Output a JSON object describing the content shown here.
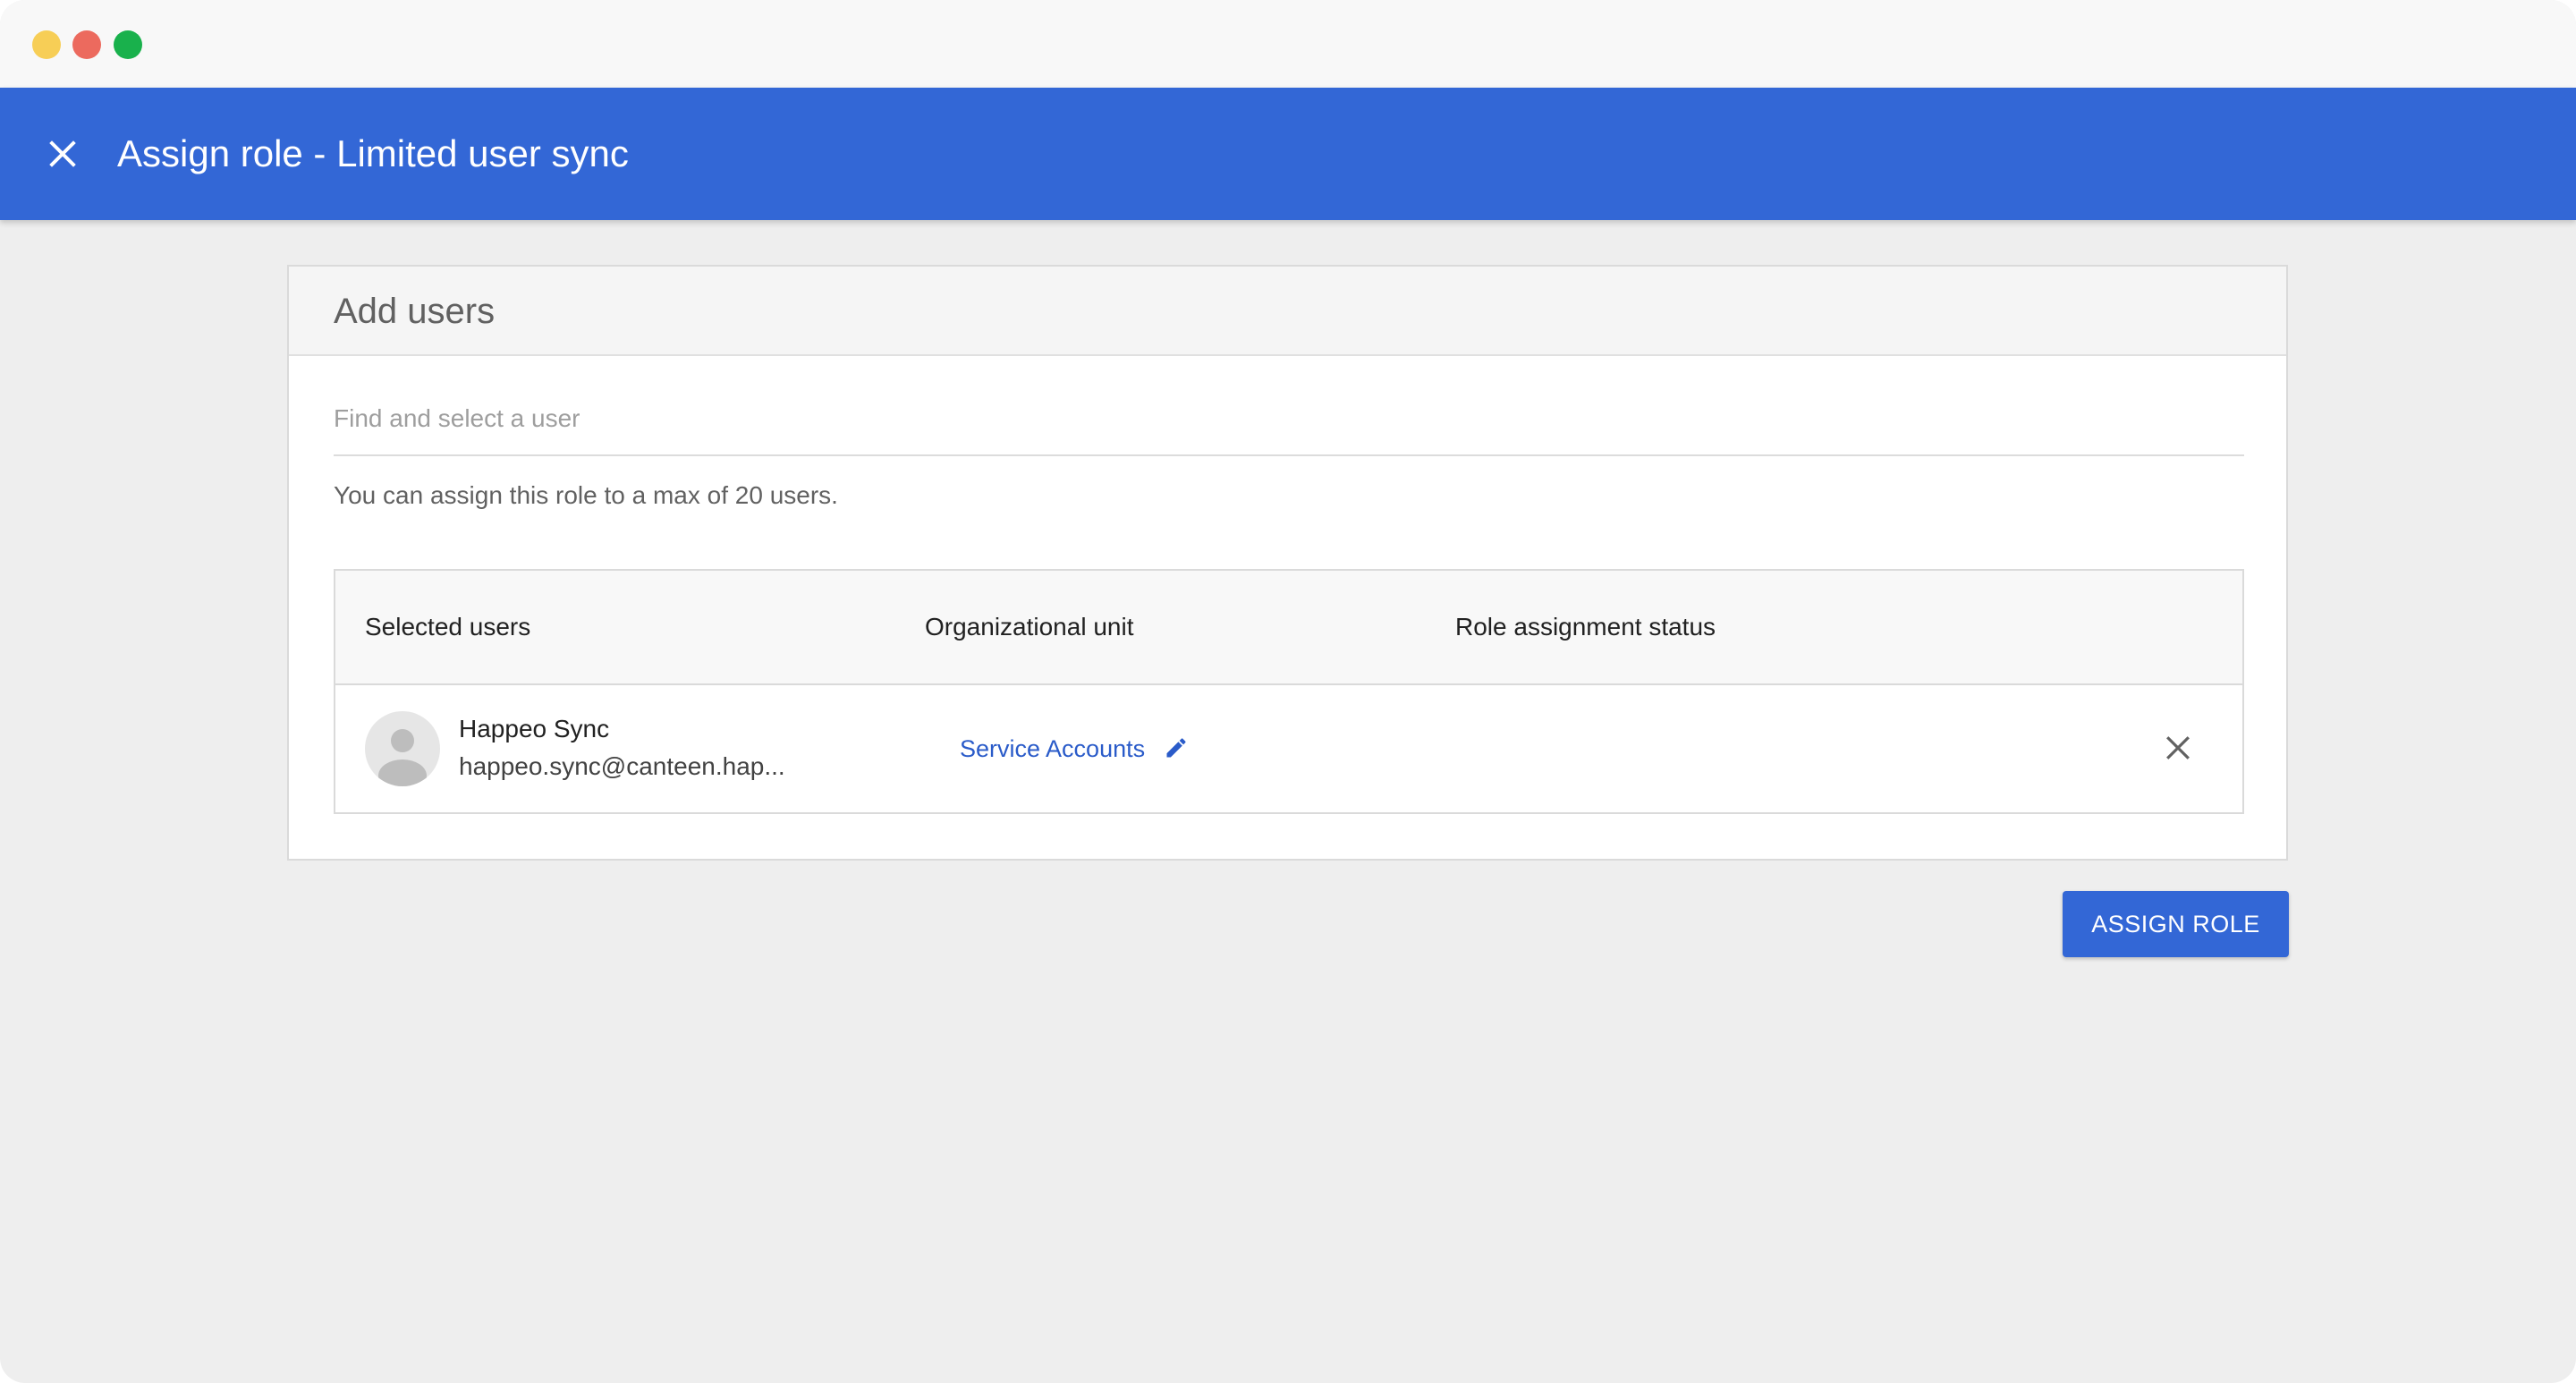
{
  "window": {
    "controls": [
      "traffic-light-close",
      "traffic-light-minimize",
      "traffic-light-zoom"
    ]
  },
  "header": {
    "title": "Assign role - Limited user sync",
    "close_icon": "close-icon",
    "background": "#3367d6"
  },
  "card": {
    "heading": "Add users",
    "search": {
      "placeholder": "Find and select a user",
      "value": ""
    },
    "hint": "You can assign this role to a max of 20 users.",
    "table": {
      "columns": [
        "Selected users",
        "Organizational unit",
        "Role assignment status"
      ],
      "rows": [
        {
          "name": "Happeo Sync",
          "email": "happeo.sync@canteen.hap...",
          "org_unit": "Service Accounts",
          "status": "",
          "avatar_icon": "person-icon",
          "edit_icon": "pencil-icon",
          "remove_icon": "close-icon"
        }
      ]
    }
  },
  "actions": {
    "assign_label": "ASSIGN ROLE"
  }
}
